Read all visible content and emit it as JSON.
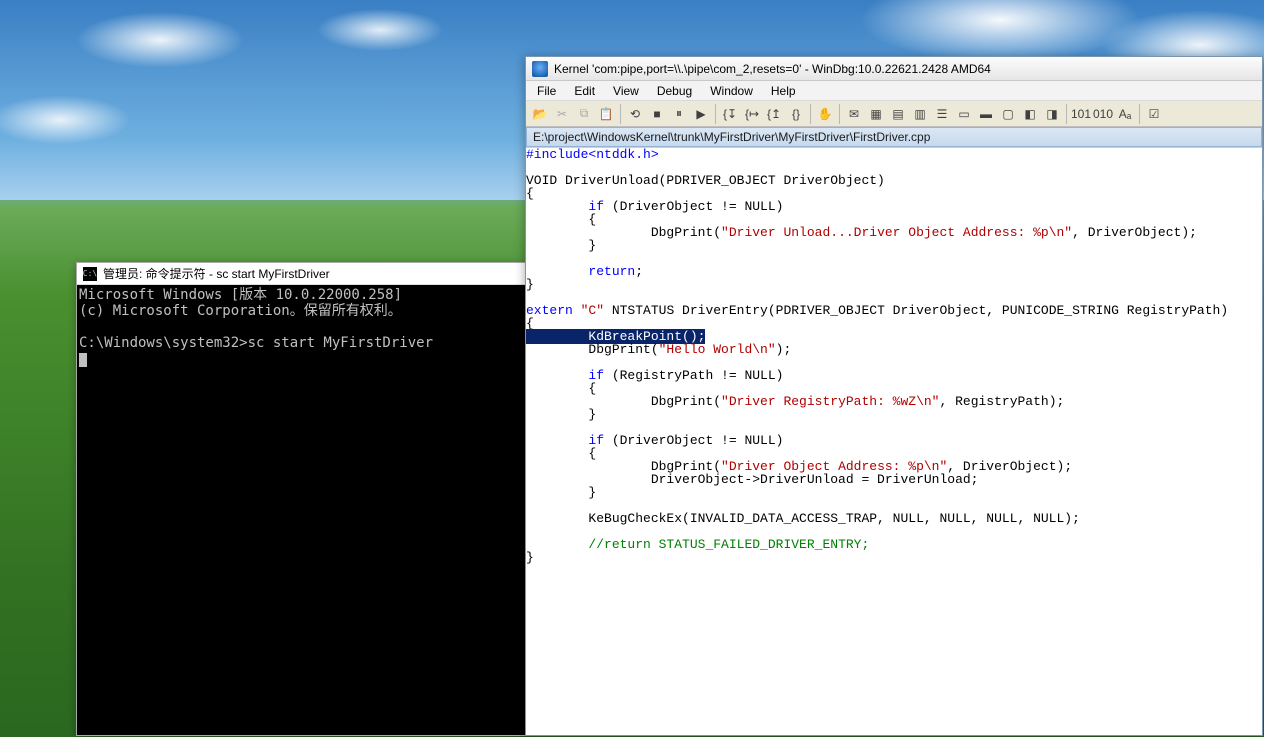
{
  "desktop": {
    "wallpaper": "bliss-xp"
  },
  "cmd": {
    "title": "管理员: 命令提示符 - sc  start MyFirstDriver",
    "icon_label": "C:\\",
    "lines": [
      "Microsoft Windows [版本 10.0.22000.258]",
      "(c) Microsoft Corporation。保留所有权利。",
      "",
      "C:\\Windows\\system32>sc start MyFirstDriver"
    ]
  },
  "windbg": {
    "title": "Kernel 'com:pipe,port=\\\\.\\pipe\\com_2,resets=0' - WinDbg:10.0.22621.2428 AMD64",
    "menu": [
      "File",
      "Edit",
      "View",
      "Debug",
      "Window",
      "Help"
    ],
    "toolbar_icons": [
      "open",
      "cut",
      "copy",
      "paste",
      "|",
      "restart",
      "stop",
      "break",
      "go",
      "|",
      "step-into",
      "step-over",
      "step-out",
      "run-to",
      "|",
      "hand",
      "|",
      "mail",
      "registers",
      "locals",
      "watch",
      "callstack",
      "disasm",
      "memory",
      "command",
      "processes",
      "threads",
      "|",
      "bits-on",
      "bits-off",
      "font",
      "|",
      "options"
    ],
    "toolbar_glyphs": {
      "open": "📂",
      "cut": "✂",
      "copy": "⧉",
      "paste": "📋",
      "restart": "⟲",
      "stop": "■",
      "break": "⏸",
      "go": "▶",
      "step-into": "{↧",
      "step-over": "{↦",
      "step-out": "{↥",
      "run-to": "{}",
      "hand": "✋",
      "mail": "✉",
      "registers": "▦",
      "locals": "▤",
      "watch": "▥",
      "callstack": "☰",
      "disasm": "▭",
      "memory": "▬",
      "command": "▢",
      "processes": "◧",
      "threads": "◨",
      "bits-on": "101",
      "bits-off": "010",
      "font": "Aₐ",
      "options": "☑"
    },
    "dimmed_icons": [
      "cut",
      "copy",
      "paste"
    ],
    "path": "E:\\project\\WindowsKernel\\trunk\\MyFirstDriver\\MyFirstDriver\\FirstDriver.cpp",
    "code": [
      {
        "t": "kw",
        "s": "#include"
      },
      {
        "t": "kw",
        "s": "<ntddk.h>"
      },
      {
        "t": "nl"
      },
      {
        "t": "nl"
      },
      {
        "t": "p",
        "s": "VOID DriverUnload(PDRIVER_OBJECT DriverObject)"
      },
      {
        "t": "nl"
      },
      {
        "t": "p",
        "s": "{"
      },
      {
        "t": "nl"
      },
      {
        "t": "p",
        "s": "        "
      },
      {
        "t": "kw",
        "s": "if"
      },
      {
        "t": "p",
        "s": " (DriverObject != NULL)"
      },
      {
        "t": "nl"
      },
      {
        "t": "p",
        "s": "        {"
      },
      {
        "t": "nl"
      },
      {
        "t": "p",
        "s": "                DbgPrint("
      },
      {
        "t": "str",
        "s": "\"Driver Unload...Driver Object Address: %p\\n\""
      },
      {
        "t": "p",
        "s": ", DriverObject);"
      },
      {
        "t": "nl"
      },
      {
        "t": "p",
        "s": "        }"
      },
      {
        "t": "nl"
      },
      {
        "t": "nl"
      },
      {
        "t": "p",
        "s": "        "
      },
      {
        "t": "kw",
        "s": "return"
      },
      {
        "t": "p",
        "s": ";"
      },
      {
        "t": "nl"
      },
      {
        "t": "p",
        "s": "}"
      },
      {
        "t": "nl"
      },
      {
        "t": "nl"
      },
      {
        "t": "kw",
        "s": "extern"
      },
      {
        "t": "p",
        "s": " "
      },
      {
        "t": "str",
        "s": "\"C\""
      },
      {
        "t": "p",
        "s": " NTSTATUS DriverEntry(PDRIVER_OBJECT DriverObject, PUNICODE_STRING RegistryPath)"
      },
      {
        "t": "nl"
      },
      {
        "t": "p",
        "s": "{"
      },
      {
        "t": "nl"
      },
      {
        "t": "hl",
        "s": "        KdBreakPoint();"
      },
      {
        "t": "nl"
      },
      {
        "t": "p",
        "s": "        DbgPrint("
      },
      {
        "t": "str",
        "s": "\"Hello World\\n\""
      },
      {
        "t": "p",
        "s": ");"
      },
      {
        "t": "nl"
      },
      {
        "t": "nl"
      },
      {
        "t": "p",
        "s": "        "
      },
      {
        "t": "kw",
        "s": "if"
      },
      {
        "t": "p",
        "s": " (RegistryPath != NULL)"
      },
      {
        "t": "nl"
      },
      {
        "t": "p",
        "s": "        {"
      },
      {
        "t": "nl"
      },
      {
        "t": "p",
        "s": "                DbgPrint("
      },
      {
        "t": "str",
        "s": "\"Driver RegistryPath: %wZ\\n\""
      },
      {
        "t": "p",
        "s": ", RegistryPath);"
      },
      {
        "t": "nl"
      },
      {
        "t": "p",
        "s": "        }"
      },
      {
        "t": "nl"
      },
      {
        "t": "nl"
      },
      {
        "t": "p",
        "s": "        "
      },
      {
        "t": "kw",
        "s": "if"
      },
      {
        "t": "p",
        "s": " (DriverObject != NULL)"
      },
      {
        "t": "nl"
      },
      {
        "t": "p",
        "s": "        {"
      },
      {
        "t": "nl"
      },
      {
        "t": "p",
        "s": "                DbgPrint("
      },
      {
        "t": "str",
        "s": "\"Driver Object Address: %p\\n\""
      },
      {
        "t": "p",
        "s": ", DriverObject);"
      },
      {
        "t": "nl"
      },
      {
        "t": "p",
        "s": "                DriverObject->DriverUnload = DriverUnload;"
      },
      {
        "t": "nl"
      },
      {
        "t": "p",
        "s": "        }"
      },
      {
        "t": "nl"
      },
      {
        "t": "nl"
      },
      {
        "t": "p",
        "s": "        KeBugCheckEx(INVALID_DATA_ACCESS_TRAP, NULL, NULL, NULL, NULL);"
      },
      {
        "t": "nl"
      },
      {
        "t": "nl"
      },
      {
        "t": "p",
        "s": "        "
      },
      {
        "t": "cmt",
        "s": "//return STATUS_FAILED_DRIVER_ENTRY;"
      },
      {
        "t": "nl"
      },
      {
        "t": "p",
        "s": "}"
      },
      {
        "t": "nl"
      }
    ]
  }
}
